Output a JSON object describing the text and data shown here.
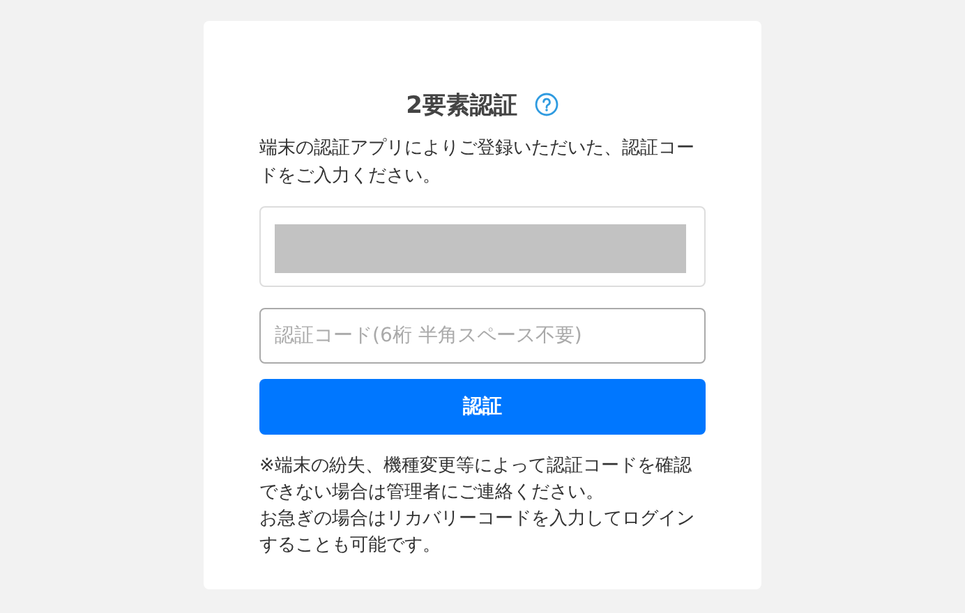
{
  "title": "2要素認証",
  "description": "端末の認証アプリによりご登録いただいた、認証コードをご入力ください。",
  "account_panel": {
    "redacted": true
  },
  "code_field": {
    "placeholder": "認証コード(6桁 半角スペース不要)"
  },
  "submit_button": "認証",
  "notes": [
    "※端末の紛失、機種変更等によって認証コードを確認できない場合は管理者にご連絡ください。",
    "お急ぎの場合はリカバリーコードを入力してログインすることも可能です。"
  ]
}
